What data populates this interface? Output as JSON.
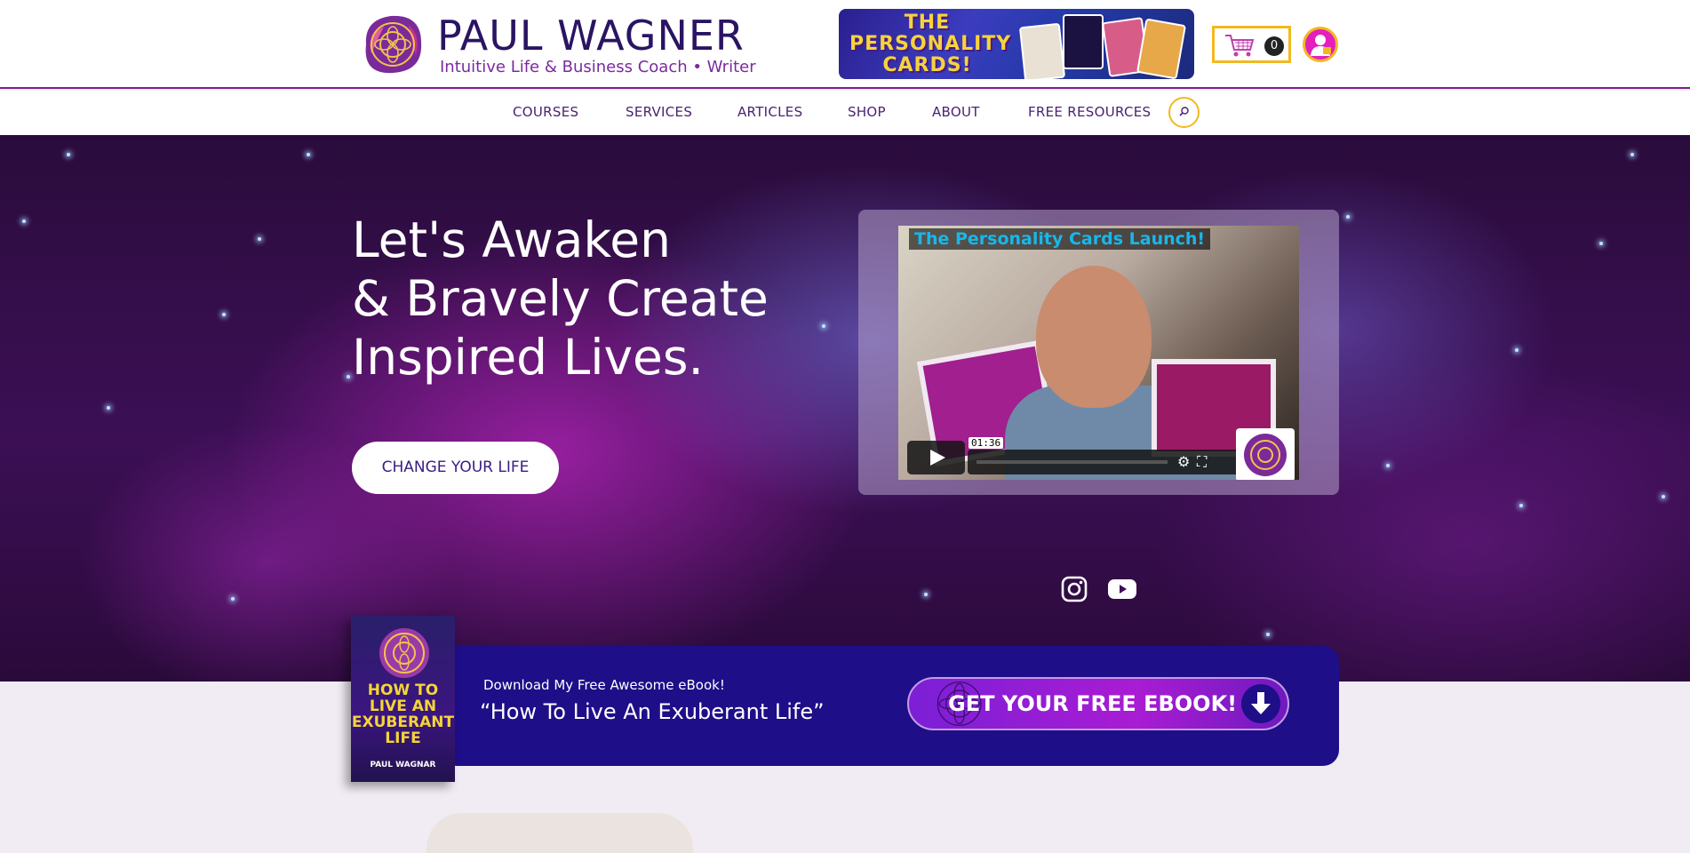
{
  "header": {
    "logo_name": "PAUL WAGNER",
    "logo_tagline": "Intuitive Life & Business Coach • Writer",
    "promo_title": "THE PERSONALITY CARDS!",
    "cart_count": "0"
  },
  "nav": {
    "items": [
      "COURSES",
      "SERVICES",
      "ARTICLES",
      "SHOP",
      "ABOUT",
      "FREE RESOURCES"
    ]
  },
  "hero": {
    "headline_line1": "Let's Awaken",
    "headline_line2": "& Bravely Create",
    "headline_line3": "Inspired Lives.",
    "cta_label": "CHANGE YOUR LIFE",
    "video_title": "The Personality Cards Launch!",
    "video_time": "01:36"
  },
  "ebook": {
    "small_text": "Download My Free Awesome eBook!",
    "big_text": "“How To Live An Exuberant Life”",
    "button_label": "GET YOUR FREE EBOOK!",
    "book_title": "HOW TO LIVE AN EXUBERANT LIFE",
    "book_author": "PAUL WAGNAR"
  },
  "colors": {
    "brand_purple": "#2a1463",
    "accent_gold": "#f1b81f",
    "banner_blue": "#1e0e88",
    "magenta": "#e31fbe"
  },
  "icons": {
    "logo": "mandala-logo-icon",
    "cart": "shopping-cart-icon",
    "account": "user-lock-icon",
    "search": "search-icon",
    "instagram": "instagram-icon",
    "youtube": "youtube-icon",
    "download": "arrow-down-icon"
  }
}
